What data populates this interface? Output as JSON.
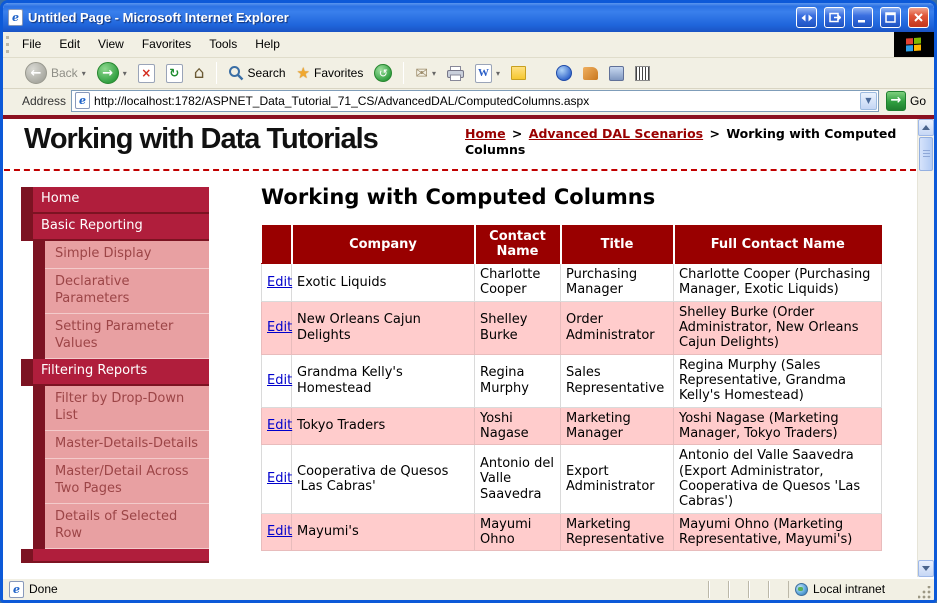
{
  "window": {
    "title": "Untitled Page - Microsoft Internet Explorer",
    "status": "Done",
    "zone": "Local intranet"
  },
  "menu": {
    "items": [
      "File",
      "Edit",
      "View",
      "Favorites",
      "Tools",
      "Help"
    ]
  },
  "toolbar": {
    "back": "Back",
    "search": "Search",
    "favorites": "Favorites"
  },
  "address": {
    "label": "Address",
    "url": "http://localhost:1782/ASPNET_Data_Tutorial_71_CS/AdvancedDAL/ComputedColumns.aspx",
    "go": "Go"
  },
  "header": {
    "site_title": "Working with Data Tutorials",
    "breadcrumb": {
      "home": "Home",
      "sep": ">",
      "section": "Advanced DAL Scenarios",
      "current": "Working with Computed Columns"
    }
  },
  "sidebar": {
    "items": [
      {
        "label": "Home",
        "level": "top"
      },
      {
        "label": "Basic Reporting",
        "level": "top"
      },
      {
        "label": "Simple Display",
        "level": "sub"
      },
      {
        "label": "Declarative Parameters",
        "level": "sub"
      },
      {
        "label": "Setting Parameter Values",
        "level": "sub"
      },
      {
        "label": "Filtering Reports",
        "level": "top"
      },
      {
        "label": "Filter by Drop-Down List",
        "level": "sub"
      },
      {
        "label": "Master-Details-Details",
        "level": "sub"
      },
      {
        "label": "Master/Detail Across Two Pages",
        "level": "sub"
      },
      {
        "label": "Details of Selected Row",
        "level": "sub"
      }
    ]
  },
  "main": {
    "page_title": "Working with Computed Columns",
    "table": {
      "headers": [
        "Company",
        "Contact Name",
        "Title",
        "Full Contact Name"
      ],
      "edit_label": "Edit",
      "rows": [
        {
          "company": "Exotic Liquids",
          "contact": "Charlotte Cooper",
          "title": "Purchasing Manager",
          "full": "Charlotte Cooper (Purchasing Manager, Exotic Liquids)"
        },
        {
          "company": "New Orleans Cajun Delights",
          "contact": "Shelley Burke",
          "title": "Order Administrator",
          "full": "Shelley Burke (Order Administrator, New Orleans Cajun Delights)"
        },
        {
          "company": "Grandma Kelly's Homestead",
          "contact": "Regina Murphy",
          "title": "Sales Representative",
          "full": "Regina Murphy (Sales Representative, Grandma Kelly's Homestead)"
        },
        {
          "company": "Tokyo Traders",
          "contact": "Yoshi Nagase",
          "title": "Marketing Manager",
          "full": "Yoshi Nagase (Marketing Manager, Tokyo Traders)"
        },
        {
          "company": "Cooperativa de Quesos 'Las Cabras'",
          "contact": "Antonio del Valle Saavedra",
          "title": "Export Administrator",
          "full": "Antonio del Valle Saavedra (Export Administrator, Cooperativa de Quesos 'Las Cabras')"
        },
        {
          "company": "Mayumi's",
          "contact": "Mayumi Ohno",
          "title": "Marketing Representative",
          "full": "Mayumi Ohno (Marketing Representative, Mayumi's)"
        }
      ]
    }
  },
  "icons": {
    "ie_e": "e",
    "back_arrow": "←",
    "forward_arrow": "→",
    "dropdown_caret": "▾",
    "stop_x": "×",
    "refresh_arrows": "↻",
    "home_house": "⌂",
    "favorites_star": "★",
    "history_arrow": "↺",
    "mail_envelope": "✉",
    "word_w": "W",
    "go_arrow": "→",
    "address_caret": "▼"
  },
  "colors": {
    "titlebar_blue": "#2066DC",
    "chrome_tan": "#F2F0E4",
    "maroon_rule": "#8B1120",
    "table_header": "#990000",
    "alt_row_pink": "#FFCCCC",
    "sidebar_crimson": "#B01E3C",
    "sidebar_dark": "#7C1322",
    "sidebar_pink": "#E8A0A2",
    "breadcrumb_link": "#990000",
    "edit_link_blue": "#0000CC"
  }
}
